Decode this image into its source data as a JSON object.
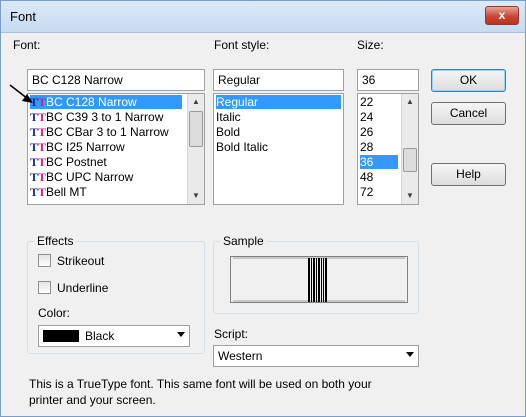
{
  "window": {
    "title": "Font",
    "close_label": "x"
  },
  "font": {
    "label": "Font:",
    "value": "BC C128 Narrow",
    "items": [
      "BC C128 Narrow",
      "BC C39 3 to 1 Narrow",
      "BC CBar 3 to 1 Narrow",
      "BC I25 Narrow",
      "BC Postnet",
      "BC UPC Narrow",
      "Bell MT"
    ],
    "selected_index": 0
  },
  "style": {
    "label": "Font style:",
    "value": "Regular",
    "items": [
      "Regular",
      "Italic",
      "Bold",
      "Bold Italic"
    ],
    "selected_index": 0
  },
  "size": {
    "label": "Size:",
    "value": "36",
    "items": [
      "22",
      "24",
      "26",
      "28",
      "36",
      "48",
      "72"
    ],
    "selected_index": 4
  },
  "buttons": {
    "ok": "OK",
    "cancel": "Cancel",
    "help": "Help"
  },
  "effects": {
    "title": "Effects",
    "strikeout": "Strikeout",
    "underline": "Underline",
    "color_label": "Color:",
    "color_value": "Black",
    "color_swatch": "#000000"
  },
  "sample": {
    "title": "Sample"
  },
  "script": {
    "label": "Script:",
    "value": "Western"
  },
  "info": {
    "line1": "This is a TrueType font. This same font will be used on both your",
    "line2": "printer and your screen."
  },
  "colors": {
    "selection": "#3399ff",
    "title_bar": "#c7daf0",
    "close_button": "#c94734"
  }
}
